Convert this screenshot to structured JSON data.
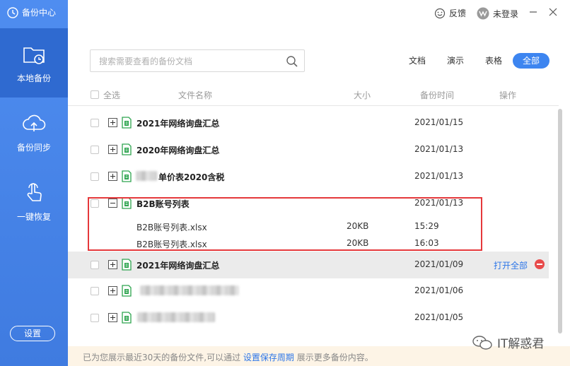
{
  "app": {
    "title": "备份中心"
  },
  "sidebar": {
    "items": [
      {
        "label": "本地备份",
        "icon": "local-backup-icon",
        "active": true
      },
      {
        "label": "备份同步",
        "icon": "cloud-upload-icon",
        "active": false
      },
      {
        "label": "一键恢复",
        "icon": "touch-restore-icon",
        "active": false
      }
    ],
    "settings_label": "设置"
  },
  "topbar": {
    "feedback_label": "反馈",
    "login_label": "未登录"
  },
  "search": {
    "placeholder": "搜索需要查看的备份文档"
  },
  "filters": [
    {
      "label": "文档",
      "active": false
    },
    {
      "label": "演示",
      "active": false
    },
    {
      "label": "表格",
      "active": false
    },
    {
      "label": "全部",
      "active": true
    }
  ],
  "table": {
    "headers": {
      "select_all": "全选",
      "name": "文件名称",
      "size": "大小",
      "time": "备份时间",
      "action": "操作"
    },
    "rows": [
      {
        "name": "2021年网络询盘汇总",
        "date": "2021/01/15"
      },
      {
        "name": "2020年网络询盘汇总",
        "date": "2021/01/13"
      },
      {
        "name": "单价表2020含税",
        "date": "2021/01/13"
      },
      {
        "name": "B2B账号列表",
        "date": "2021/01/13"
      },
      {
        "name": "2021年网络询盘汇总",
        "date": "2021/01/09"
      },
      {
        "name": "",
        "date": "2021/01/06"
      },
      {
        "name": "",
        "date": "2021/01/05"
      }
    ],
    "subrows": [
      {
        "name": "B2B账号列表.xlsx",
        "size": "20KB",
        "time": "15:29"
      },
      {
        "name": "B2B账号列表.xlsx",
        "size": "20KB",
        "time": "16:03"
      }
    ],
    "open_all_label": "打开全部"
  },
  "footer": {
    "text_before": "已为您展示最近30天的备份文件,可以通过",
    "link": "设置保存周期",
    "text_after": "展示更多备份内容。"
  },
  "watermark": "IT解惑君",
  "colors": {
    "sidebar": "#4a86e8",
    "accent": "#3d85f0",
    "highlight": "#e5383b",
    "excel_green": "#2ea44f"
  }
}
